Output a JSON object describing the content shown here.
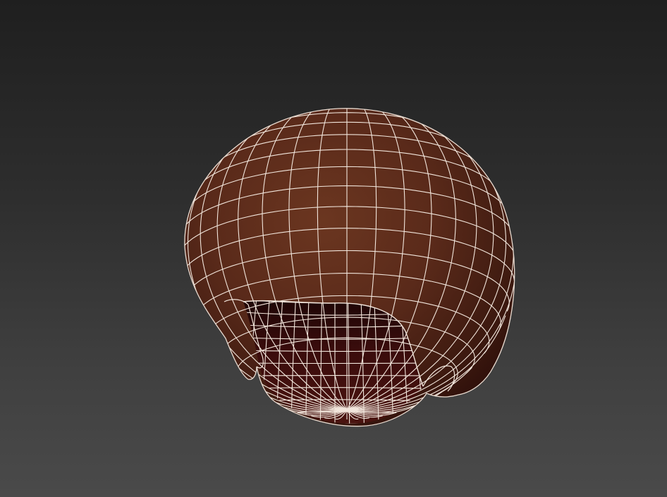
{
  "viewport": {
    "background_top": "#1f1f1f",
    "background_bottom": "#4a4a4a"
  },
  "model": {
    "object": "hair-cap-mesh",
    "display_mode": "shaded-with-wireframe",
    "base_color": "#5a2a1a",
    "shadow_color": "#2a0c08",
    "inner_color": "#3a0c0c",
    "wire_color": "#f2e6dc"
  }
}
